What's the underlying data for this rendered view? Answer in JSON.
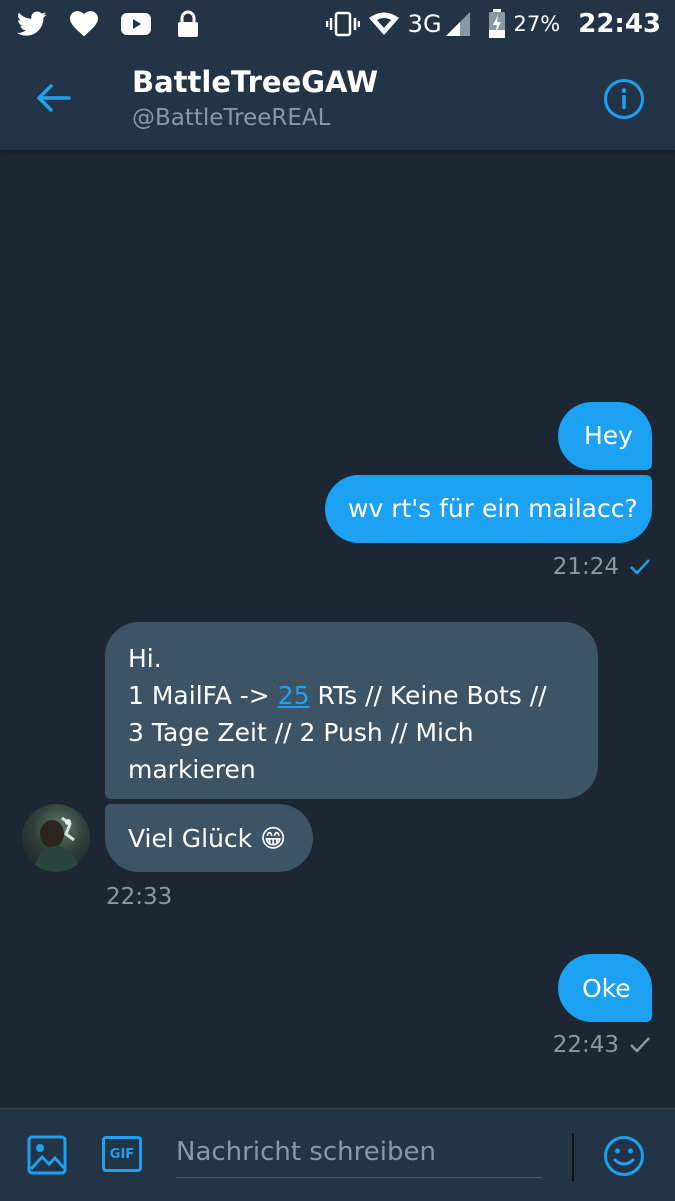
{
  "statusbar": {
    "icons_left": [
      "twitter-icon",
      "heart-icon",
      "youtube-icon",
      "lock-icon"
    ],
    "icons_right": [
      "vibrate-icon",
      "wifi-icon",
      "signal-icon",
      "battery-charging-icon"
    ],
    "network": "3G",
    "battery": "27%",
    "time": "22:43"
  },
  "header": {
    "name": "BattleTreeGAW",
    "handle": "@BattleTreeREAL"
  },
  "messages": {
    "m1": "Hey",
    "m2": "wv rt's für ein mailacc?",
    "ts1": "21:24",
    "m3_line1": "Hi.",
    "m3_line2_a": "1 MailFA -> ",
    "m3_line2_link": "25",
    "m3_line2_b": " RTs // Keine Bots //",
    "m3_line3": "3 Tage Zeit // 2 Push // Mich",
    "m3_line4": "markieren",
    "m4_text": "Viel Glück ",
    "m4_emoji": "😁",
    "ts2": "22:33",
    "m5": "Oke",
    "ts3": "22:43"
  },
  "composer": {
    "placeholder": "Nachricht schreiben",
    "gif_label": "GIF"
  },
  "colors": {
    "background": "#1c2733",
    "bar": "#243447",
    "accent": "#1da1f2",
    "incoming_bubble": "#3d5466",
    "muted": "#8899a6"
  }
}
